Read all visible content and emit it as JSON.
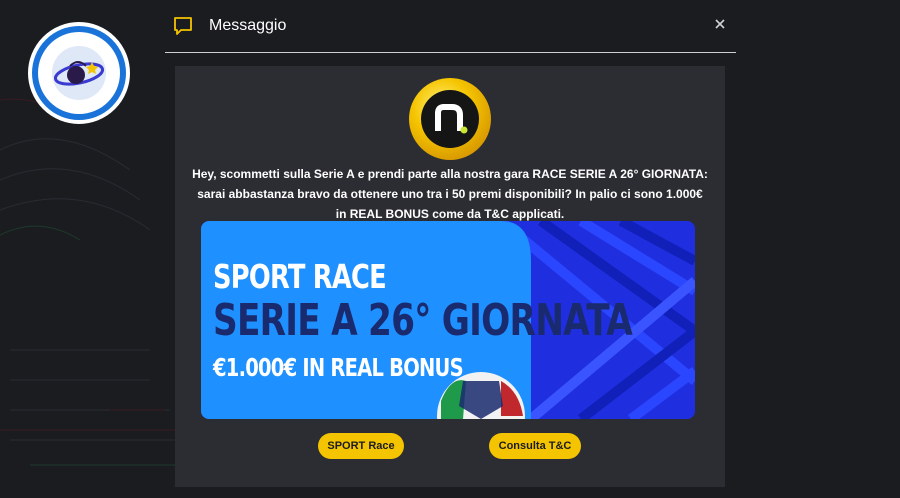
{
  "header": {
    "title": "Messaggio",
    "icon": "message-icon",
    "close_icon": "close-icon"
  },
  "message": {
    "text": "Hey, scommetti sulla Serie A e prendi parte alla nostra gara RACE SERIE A 26° GIORNATA: sarai abbastanza bravo da ottenere uno tra i 50 premi disponibili? In palio ci sono 1.000€ in REAL BONUS come da T&C applicati."
  },
  "banner": {
    "title": "SPORT RACE",
    "subtitle": "SERIE A 26° GIORNATA",
    "prize": "€1.000€ IN REAL BONUS"
  },
  "buttons": {
    "sport_race": "SPORT Race",
    "terms": "Consulta T&C"
  },
  "colors": {
    "background": "#1b1c20",
    "panel": "#2b2d33",
    "accent": "#f5c400",
    "banner_blue": "#1f2fe0",
    "banner_light": "#1e90ff"
  }
}
